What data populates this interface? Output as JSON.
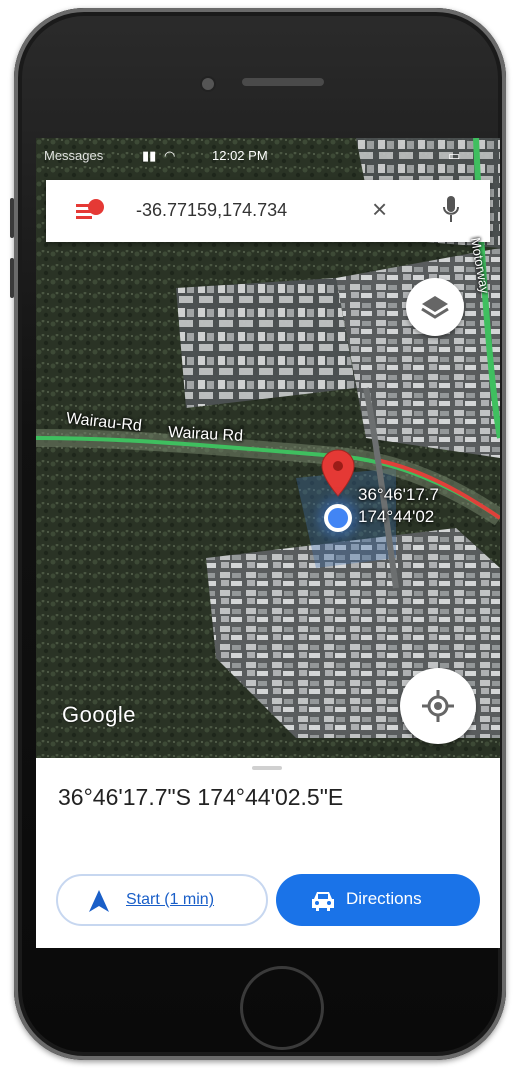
{
  "status_bar": {
    "carrier": "Messages",
    "time": "12:02 PM"
  },
  "search": {
    "query": "-36.77159,174.734",
    "clear_icon": "close-icon",
    "mic_icon": "microphone-icon"
  },
  "map": {
    "road_label_1": "Wairau-Rd",
    "road_label_2": "Wairau Rd",
    "side_road_label": "Motorway",
    "pin_coord_line1": "36°46'17.7",
    "pin_coord_line2": "174°44'02",
    "logo": "Google",
    "layers_icon": "layers-icon",
    "locate_icon": "my-location-icon"
  },
  "place_sheet": {
    "coordinates": "36°46'17.7\"S 174°44'02.5\"E",
    "start_label": "Start (1 min)",
    "directions_label": "Directions"
  },
  "colors": {
    "accent": "#1a73e8",
    "pin": "#e53935",
    "location_dot": "#4285f4"
  }
}
